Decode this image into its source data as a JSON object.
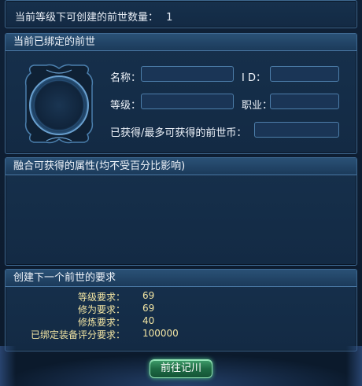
{
  "top": {
    "count_label": "当前等级下可创建的前世数量：",
    "count_value": "1"
  },
  "bound": {
    "header": "当前已绑定的前世",
    "name_label": "名称：",
    "id_label": "I D：",
    "level_label": "等级：",
    "job_label": "职业：",
    "coins_label": "已获得/最多可获得的前世币：",
    "name_value": "",
    "id_value": "",
    "level_value": "",
    "job_value": "",
    "coins_value": ""
  },
  "attributes": {
    "header": "融合可获得的属性(均不受百分比影响)"
  },
  "requirements": {
    "header": "创建下一个前世的要求",
    "rows": [
      {
        "label": "等级要求：",
        "value": "69"
      },
      {
        "label": "修为要求：",
        "value": "69"
      },
      {
        "label": "修炼要求：",
        "value": "40"
      },
      {
        "label": "已绑定装备评分要求：",
        "value": "100000"
      }
    ]
  },
  "actions": {
    "go_button": "前往记川"
  },
  "colors": {
    "panel_border": "#3f6a93",
    "requirement_text": "#f3e6a4",
    "button_green": "#1e6b44"
  }
}
